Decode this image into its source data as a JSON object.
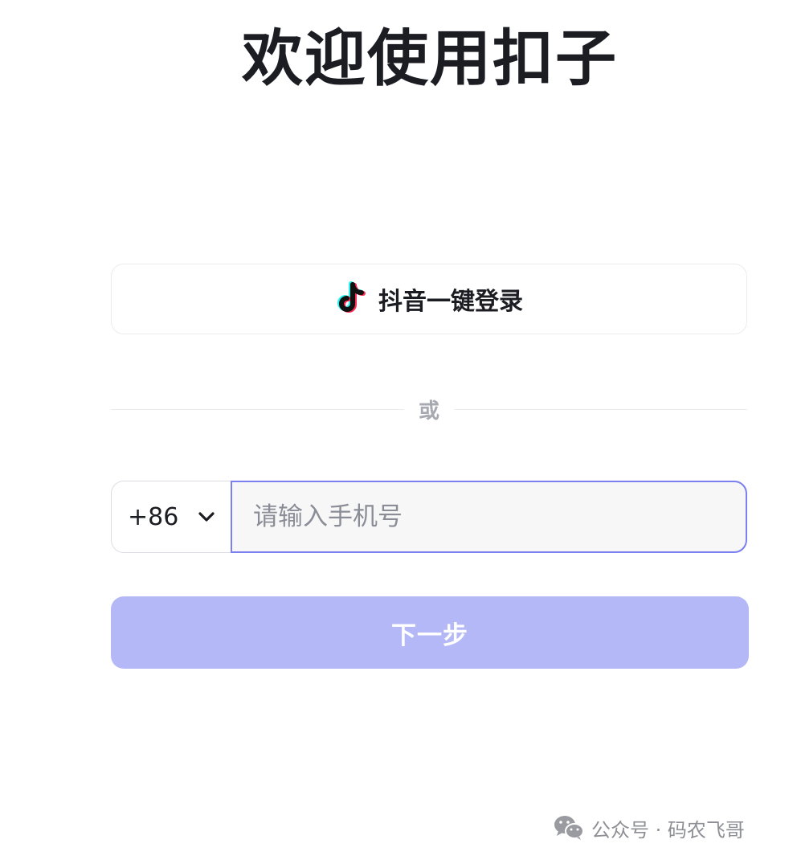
{
  "header": {
    "title": "欢迎使用扣子"
  },
  "douyin_login": {
    "icon": "douyin-icon",
    "label": "抖音一键登录"
  },
  "divider": {
    "text": "或"
  },
  "phone": {
    "country_code": "+86",
    "placeholder": "请输入手机号",
    "value": ""
  },
  "next_button": {
    "label": "下一步"
  },
  "watermark": {
    "icon": "wechat-icon",
    "text": "公众号 · 码农飞哥"
  },
  "colors": {
    "primary_disabled": "#b5b8f7",
    "focus_border": "#7b7ff0",
    "text": "#1c1d23",
    "muted": "#a7a9b0"
  }
}
